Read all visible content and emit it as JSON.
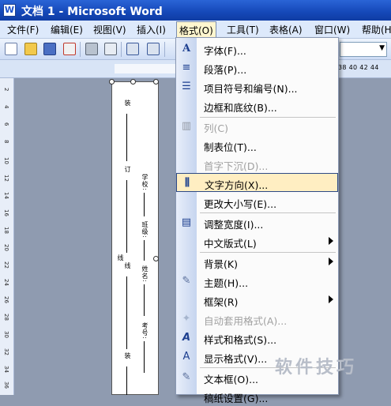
{
  "window": {
    "title": "文档 1 - Microsoft Word",
    "app_icon": "W"
  },
  "menubar": {
    "items": [
      "文件(F)",
      "编辑(E)",
      "视图(V)",
      "插入(I)",
      "格式(O)",
      "工具(T)",
      "表格(A)",
      "窗口(W)",
      "帮助(H)"
    ],
    "active_index": 4
  },
  "ruler": {
    "numbers": "38  40  42  44"
  },
  "vruler": {
    "ticks": [
      "2",
      "4",
      "6",
      "8",
      "10",
      "12",
      "14",
      "16",
      "18",
      "20",
      "22",
      "24",
      "26",
      "28",
      "30",
      "32",
      "34",
      "36"
    ]
  },
  "document": {
    "left_marks": [
      "装",
      "订",
      "线",
      "线",
      "装"
    ],
    "field_labels": [
      "学校:",
      "班级:",
      "姓名:",
      "考号:"
    ]
  },
  "format_menu": {
    "items": [
      {
        "label": "字体(F)...",
        "icon": "font-A-icon",
        "glyph": "A",
        "enabled": true
      },
      {
        "label": "段落(P)...",
        "icon": "paragraph-icon",
        "glyph": "≡",
        "enabled": true
      },
      {
        "label": "项目符号和编号(N)...",
        "icon": "bullets-icon",
        "glyph": "☰",
        "enabled": true
      },
      {
        "label": "边框和底纹(B)...",
        "icon": "",
        "glyph": "",
        "enabled": true
      },
      {
        "label": "列(C)",
        "icon": "columns-icon",
        "glyph": "▥",
        "enabled": false
      },
      {
        "label": "制表位(T)...",
        "icon": "",
        "glyph": "",
        "enabled": true
      },
      {
        "label": "首字下沉(D)...",
        "icon": "",
        "glyph": "",
        "enabled": false
      },
      {
        "label": "文字方向(X)...",
        "icon": "text-direction-icon",
        "glyph": "⫼",
        "enabled": true,
        "highlighted": true
      },
      {
        "label": "更改大小写(E)...",
        "icon": "",
        "glyph": "",
        "enabled": true
      },
      {
        "label": "调整宽度(I)...",
        "icon": "fit-width-icon",
        "glyph": "▤",
        "enabled": true
      },
      {
        "label": "中文版式(L)",
        "icon": "",
        "glyph": "",
        "enabled": true,
        "submenu": true
      },
      {
        "label": "背景(K)",
        "icon": "",
        "glyph": "",
        "enabled": true,
        "submenu": true
      },
      {
        "label": "主题(H)...",
        "icon": "theme-icon",
        "glyph": "✎",
        "enabled": true
      },
      {
        "label": "框架(R)",
        "icon": "",
        "glyph": "",
        "enabled": true,
        "submenu": true
      },
      {
        "label": "自动套用格式(A)...",
        "icon": "autoformat-icon",
        "glyph": "✦",
        "enabled": false
      },
      {
        "label": "样式和格式(S)...",
        "icon": "styles-icon",
        "glyph": "A",
        "enabled": true
      },
      {
        "label": "显示格式(V)...",
        "icon": "reveal-format-icon",
        "glyph": "A",
        "enabled": true
      },
      {
        "label": "文本框(O)...",
        "icon": "textbox-icon",
        "glyph": "✎",
        "enabled": true
      },
      {
        "label": "稿纸设置(G)...",
        "icon": "",
        "glyph": "",
        "enabled": true
      }
    ]
  },
  "watermark": "软件技巧",
  "colors": {
    "titlebar": "#1548b8",
    "menu_highlight": "#ffeec2",
    "accent": "#2e4a86"
  }
}
